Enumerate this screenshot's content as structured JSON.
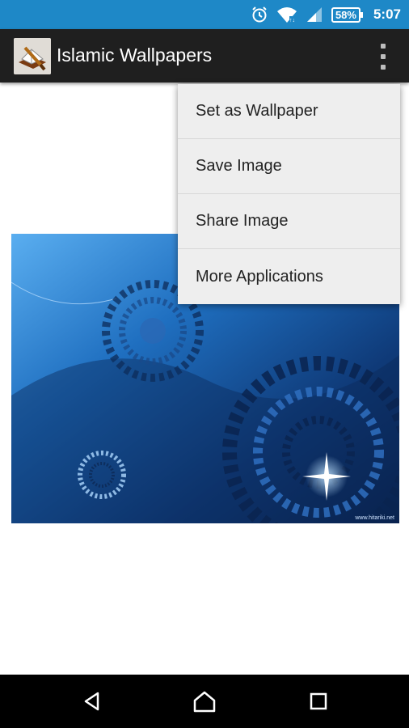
{
  "status_bar": {
    "battery": "58%",
    "time": "5:07",
    "icons": [
      "alarm-icon",
      "wifi-icon",
      "signal-icon",
      "battery-icon"
    ]
  },
  "app_bar": {
    "title": "Islamic Wallpapers",
    "app_icon": "quran-icon",
    "overflow_icon": "more-vert-icon"
  },
  "menu": {
    "items": [
      {
        "label": "Set as Wallpaper"
      },
      {
        "label": "Save Image"
      },
      {
        "label": "Share Image"
      },
      {
        "label": "More Applications"
      }
    ]
  },
  "wallpaper": {
    "watermark": "www.hitariki.net",
    "colors": {
      "light": "#4fa8e8",
      "dark": "#0a1f45"
    }
  },
  "nav_bar": {
    "icons": [
      "back-icon",
      "home-icon",
      "recents-icon"
    ]
  }
}
